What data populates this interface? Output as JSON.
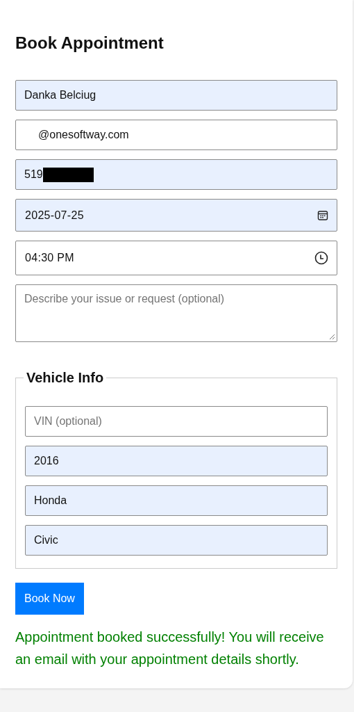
{
  "title": "Book Appointment",
  "fields": [
    {
      "kind": "text",
      "value": "Danka Belciug",
      "autofilled": true
    },
    {
      "kind": "email",
      "value": "@onesoftway.com",
      "autofilled": false
    },
    {
      "kind": "phone",
      "value": "519",
      "redacted": true,
      "autofilled": true
    },
    {
      "kind": "date",
      "value": "2025-07-25",
      "autofilled": true
    },
    {
      "kind": "time",
      "value": "04:30 PM",
      "autofilled": false
    },
    {
      "kind": "textarea",
      "placeholder": "Describe your issue or request (optional)",
      "autofilled": false
    }
  ],
  "vehicle": {
    "legend": "Vehicle Info",
    "fields": [
      {
        "placeholder": "VIN (optional)",
        "autofilled": false
      },
      {
        "value": "2016",
        "autofilled": true
      },
      {
        "value": "Honda",
        "autofilled": true
      },
      {
        "value": "Civic",
        "autofilled": true
      }
    ]
  },
  "button": "Book Now",
  "message": "Appointment booked successfully! You will receive an email with your appointment details shortly."
}
